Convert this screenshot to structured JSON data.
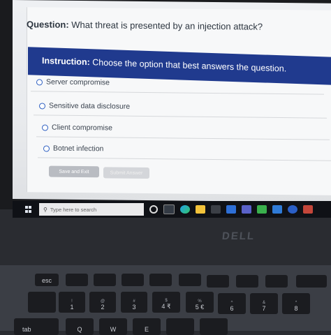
{
  "question": {
    "label": "Question:",
    "text": " What threat is presented by an injection attack?"
  },
  "instruction": {
    "label": "Instruction:",
    "text": " Choose the option that best answers the question."
  },
  "options": [
    {
      "label": "Server compromise"
    },
    {
      "label": "Sensitive data disclosure"
    },
    {
      "label": "Client compromise"
    },
    {
      "label": "Botnet infection"
    }
  ],
  "buttons": {
    "save_exit": "Save and Exit",
    "submit": "Submit Answer"
  },
  "taskbar": {
    "search_placeholder": "Type here to search"
  },
  "brand": "DELL",
  "keys": {
    "esc": "esc",
    "tab": "tab",
    "row": [
      {
        "top": "!",
        "main": "1"
      },
      {
        "top": "@",
        "main": "2"
      },
      {
        "top": "#",
        "main": "3"
      },
      {
        "top": "$",
        "main": "4 ₹"
      },
      {
        "top": "%",
        "main": "5 €"
      },
      {
        "top": "^",
        "main": "6"
      },
      {
        "top": "&",
        "main": "7"
      },
      {
        "top": "*",
        "main": "8"
      }
    ],
    "letters": [
      "Q",
      "W",
      "E"
    ]
  },
  "colors": {
    "instruction_bar": "#203a8e",
    "radio": "#2c5ec1"
  }
}
